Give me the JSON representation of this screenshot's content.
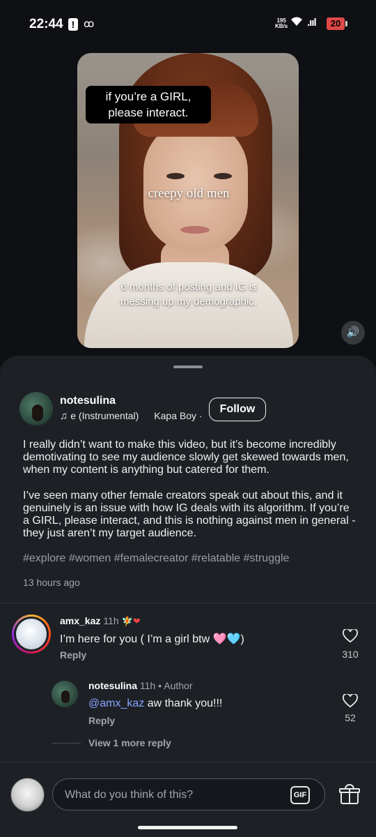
{
  "status_bar": {
    "time": "22:44",
    "alert_icon": "!",
    "tripadvisor_icon": "ꝏ",
    "net_speed_value": "195",
    "net_speed_unit": "KB/s",
    "wifi_icon": "wifi-icon",
    "signal": ".ııl",
    "battery": "20"
  },
  "video": {
    "caption_top": "if you’re a GIRL, please interact.",
    "caption_middle": "creepy old men",
    "caption_bottom": "6 months of posting and IG is messing up my demographic.",
    "sound_icon": "🔊"
  },
  "post": {
    "author": "notesulina",
    "music_note": "♫",
    "music_title": "e (Instrumental)",
    "music_artist": "Kapa Boy · F",
    "follow_label": "Follow",
    "paragraph_1": "I really didn’t want to make this video, but it’s become incredibly demotivating to see my audience slowly get skewed towards men, when my content is anything but catered for them.",
    "paragraph_2": "I’ve seen many other female creators speak out about this, and it genuinely is an issue with how IG deals with its algorithm. If you’re a GIRL, please interact, and this is nothing against men in general - they just aren’t my target audience.",
    "hashtags": "#explore #women #femalecreator #relatable #struggle",
    "posted": "13 hours ago"
  },
  "comments": [
    {
      "user": "amx_kaz",
      "time": "11h",
      "badge": "🧚❤",
      "text": "I’m here for you ( I’m a girl btw 🩷🩵)",
      "reply_label": "Reply",
      "likes": "310"
    },
    {
      "user": "notesulina",
      "time": "11h",
      "author_tag": "• Author",
      "mention": "@amx_kaz",
      "text": " aw thank you!!!",
      "reply_label": "Reply",
      "likes": "52"
    }
  ],
  "view_more": "View 1 more reply",
  "composer": {
    "placeholder": "What do you think of this?",
    "gif_label": "GIF"
  }
}
